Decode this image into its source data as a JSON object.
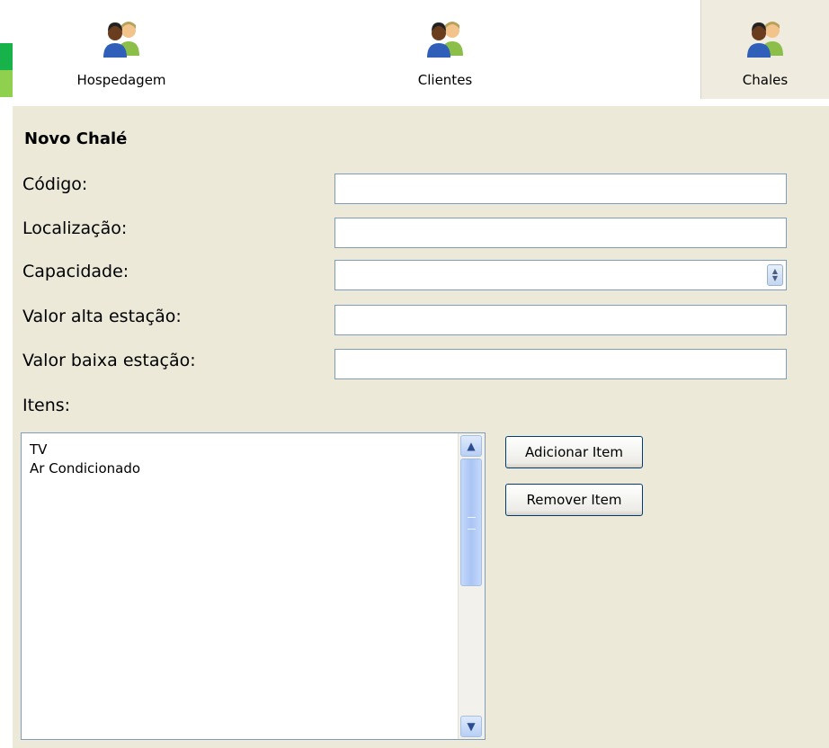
{
  "tabs": [
    {
      "label": "Hospedagem",
      "icon": "users-icon"
    },
    {
      "label": "Clientes",
      "icon": "users-icon"
    },
    {
      "label": "Chales",
      "icon": "users-icon",
      "selected": true
    }
  ],
  "form": {
    "title": "Novo Chalé",
    "fields": {
      "codigo": {
        "label": "Código:",
        "value": ""
      },
      "localizacao": {
        "label": "Localização:",
        "value": ""
      },
      "capacidade": {
        "label": "Capacidade:",
        "value": ""
      },
      "valor_alta": {
        "label": "Valor alta estação:",
        "value": ""
      },
      "valor_baixa": {
        "label": "Valor baixa estação:",
        "value": ""
      }
    },
    "itens_label": "Itens:",
    "itens": [
      "TV",
      "Ar Condicionado"
    ],
    "buttons": {
      "add": "Adicionar Item",
      "remove": "Remover Item"
    }
  },
  "colors": {
    "panel_bg": "#ece9d8",
    "input_border": "#7f9db9",
    "accent_green": "#17b34a"
  }
}
